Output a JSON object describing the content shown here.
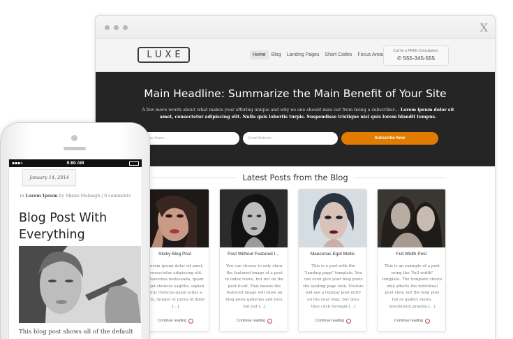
{
  "browser": {
    "close_glyph": "X",
    "logo": "LUXE",
    "nav": [
      "Home",
      "Blog",
      "Landing Pages",
      "Short Codes",
      "Focus Areas"
    ],
    "call_label": "Call for a FREE Consultation:",
    "phone_number": "555-345-555",
    "hero": {
      "title": "Main Headline: Summarize the Main Benefit of Your Site",
      "subtitle_plain": "A few more words about what makes your offering unique and why no one should miss out from being a subscriber… ",
      "subtitle_bold": "Lorem ipsum dolor sit amet, consectetur adipiscing elit. Nulla quis lobortis turpis. Suspendisse tristique nisi quis lorem blandit tempus.",
      "name_placeholder": "Your Name...",
      "email_placeholder": "Email Address...",
      "subscribe_label": "Subscribe Now"
    },
    "blog_heading": "Latest Posts from the Blog",
    "posts": [
      {
        "title": "Sticky Blog Post",
        "text": "Lorem ipsum dolor sit amet, consectetur adipiscing elit. Maecenas malesuada, quam eget rhoncus sagittis, sapien erat rhoncus quam tellus a sem, integer et purus id dolor [...]",
        "more": "Continue reading"
      },
      {
        "title": "Post Without Featured I…",
        "text": "You can choose to only show the featured image of a post in index views, but not on the post itself. That means the featured image will show on blog posts galleries and lists, but not [...]",
        "more": "Continue reading"
      },
      {
        "title": "Maecenas Eget Mollis",
        "text": "This is a post with the \"landing page\" template. You can even give your blog posts the landing page look. Visitors will see a regular post entry on the your blog, but once they click through [...]",
        "more": "Continue reading"
      },
      {
        "title": "Full Width Post",
        "text": "This is an example of a post using the \"full width\" template. The template choice only affects the individual post view, not the blog post list or gallery views. Vestibulum gravida [...]",
        "more": "Continue reading"
      }
    ]
  },
  "phone": {
    "time": "9:80 AM",
    "date": "January 14, 2014",
    "byline_in": "in",
    "category": "Lorem Ipsum",
    "byline_by": "by Shane Melaugh",
    "byline_sep": "|",
    "comments": "0 comments",
    "post_title": "Blog Post With Everything",
    "excerpt": "This blog post shows all of the default"
  },
  "colors": {
    "hero_bg": "#252525",
    "accent_orange": "#e27c00",
    "header_bg": "#f4f4f4"
  }
}
